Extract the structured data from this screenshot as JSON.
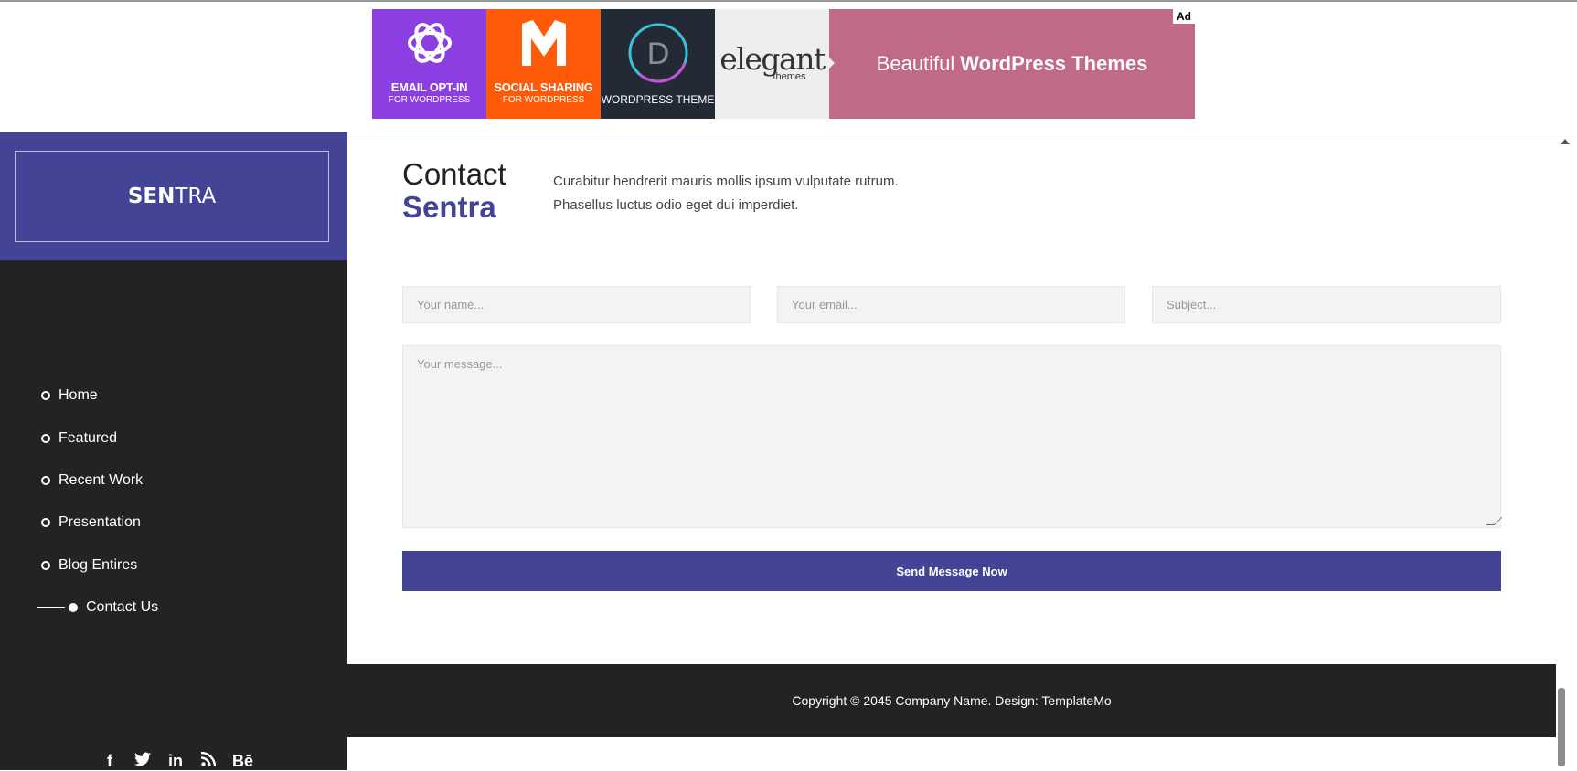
{
  "ad": {
    "badge": "Ad",
    "tiles": [
      {
        "line1": "EMAIL OPT-IN",
        "line2": "FOR WORDPRESS",
        "icon": "bloom-icon"
      },
      {
        "line1": "SOCIAL SHARING",
        "line2": "FOR WORDPRESS",
        "icon": "monarch-icon"
      },
      {
        "line1": "WORDPRESS THEME",
        "line2": "",
        "icon": "divi-icon"
      },
      {
        "logo": "elegant",
        "sub": "themes"
      }
    ],
    "cta_light": "Beautiful",
    "cta_bold": "WordPress Themes"
  },
  "brand": {
    "bold": "SEN",
    "light": "TRA"
  },
  "nav": {
    "items": [
      {
        "label": "Home"
      },
      {
        "label": "Featured"
      },
      {
        "label": "Recent Work"
      },
      {
        "label": "Presentation"
      },
      {
        "label": "Blog Entires"
      },
      {
        "label": "Contact Us",
        "active": true
      }
    ]
  },
  "social": {
    "icons": [
      "facebook-icon",
      "twitter-icon",
      "linkedin-icon",
      "rss-icon",
      "behance-icon"
    ],
    "glyphs": [
      "f",
      "t",
      "in",
      "≈",
      "Bē"
    ]
  },
  "contact": {
    "title_1": "Contact",
    "title_2": "Sentra",
    "intro_1": "Curabitur hendrerit mauris mollis ipsum vulputate rutrum.",
    "intro_2": "Phasellus luctus odio eget dui imperdiet.",
    "name_placeholder": "Your name...",
    "email_placeholder": "Your email...",
    "subject_placeholder": "Subject...",
    "message_placeholder": "Your message...",
    "send_label": "Send Message Now"
  },
  "footer": {
    "text": "Copyright © 2045 Company Name. Design: TemplateMo"
  },
  "colors": {
    "accent": "#444497",
    "dark": "#232323",
    "field_bg": "#f3f3f3"
  }
}
